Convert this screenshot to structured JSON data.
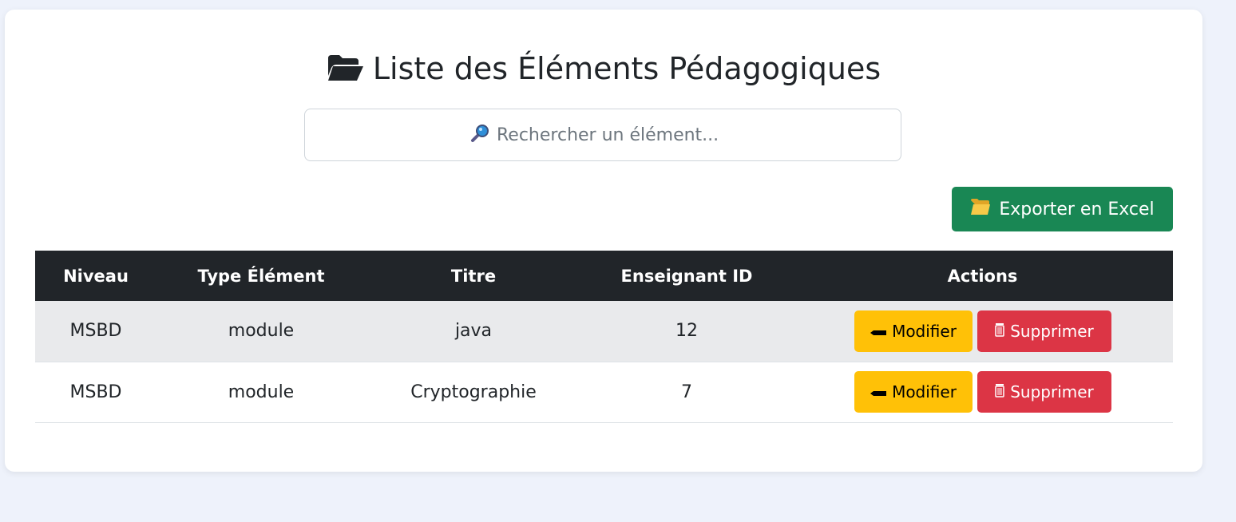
{
  "page": {
    "title": "Liste des Éléments Pédagogiques"
  },
  "search": {
    "placeholder": "Rechercher un élément...",
    "value": ""
  },
  "toolbar": {
    "export_label": "Exporter en Excel"
  },
  "table": {
    "headers": [
      "Niveau",
      "Type Élément",
      "Titre",
      "Enseignant ID",
      "Actions"
    ],
    "rows": [
      {
        "niveau": "MSBD",
        "type": "module",
        "titre": "java",
        "enseignant_id": "12",
        "edit_label": "Modifier",
        "delete_label": "Supprimer"
      },
      {
        "niveau": "MSBD",
        "type": "module",
        "titre": "Cryptographie",
        "enseignant_id": "7",
        "edit_label": "Modifier",
        "delete_label": "Supprimer"
      }
    ]
  },
  "colors": {
    "background": "#eef2fb",
    "header_bg": "#212529",
    "export_button": "#198754",
    "edit_button": "#ffc107",
    "delete_button": "#dc3545"
  },
  "icons": {
    "title": "open-folder-icon",
    "search": "magnifier-icon",
    "export": "folder-icon",
    "edit": "pencil-icon",
    "delete": "trash-icon"
  }
}
